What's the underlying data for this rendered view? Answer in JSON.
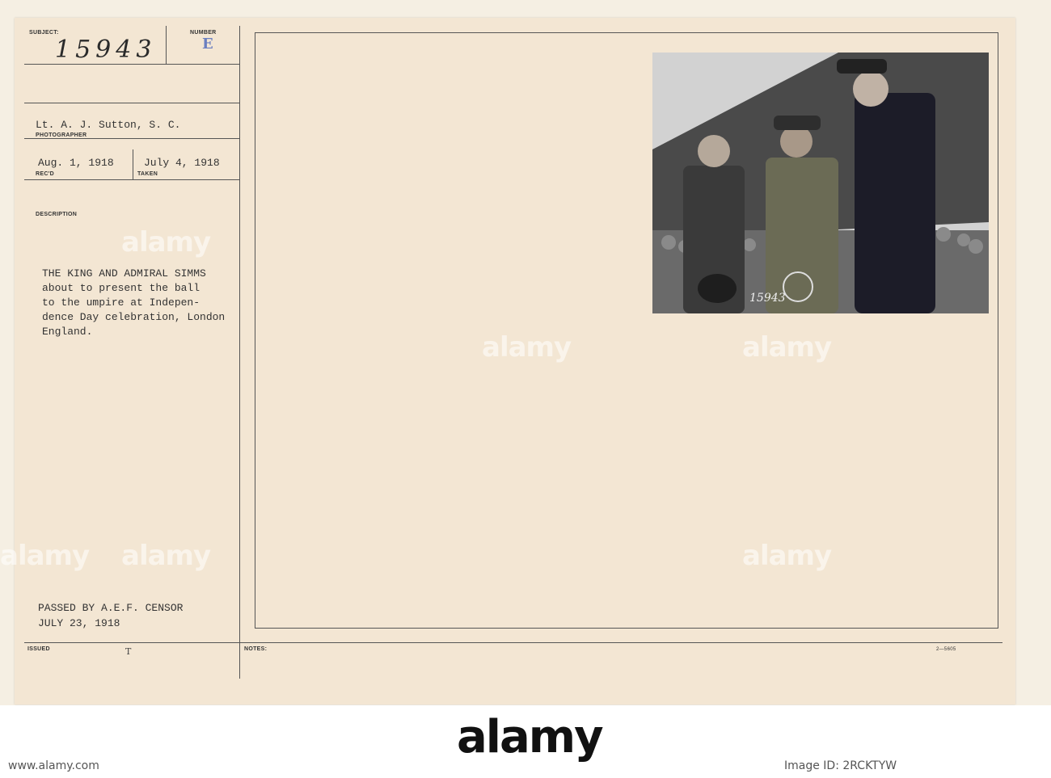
{
  "card": {
    "subject_label": "SUBJECT:",
    "subject_number": "15943",
    "number_label": "NUMBER",
    "number_letter": "E",
    "photographer_value": "Lt. A. J. Sutton, S. C.",
    "photographer_label": "PHOTOGRAPHER",
    "received_value": "Aug. 1, 1918",
    "received_label": "REC'D",
    "taken_value": "July 4, 1918",
    "taken_label": "TAKEN",
    "description_label": "DESCRIPTION",
    "description_lines": [
      "THE KING AND ADMIRAL SIMMS",
      "about to present the ball",
      "to the umpire at Indepen-",
      "dence Day celebration, London",
      "England."
    ],
    "censor_line1": "PASSED BY A.E.F. CENSOR",
    "censor_line2": "JULY 23, 1918",
    "issued_label": "ISSUED",
    "issued_mark": "T",
    "notes_label": "NOTES:",
    "form_code": "2—5605",
    "photo_number": "15943"
  },
  "watermark": {
    "text": "alamy"
  },
  "footer": {
    "logo_text": "alamy",
    "image_id": "Image ID: 2RCKTYW",
    "site": "www.alamy.com"
  },
  "colors": {
    "card": "#f3e6d3",
    "stamp_red": "#c0393b",
    "ink": "#333333"
  }
}
